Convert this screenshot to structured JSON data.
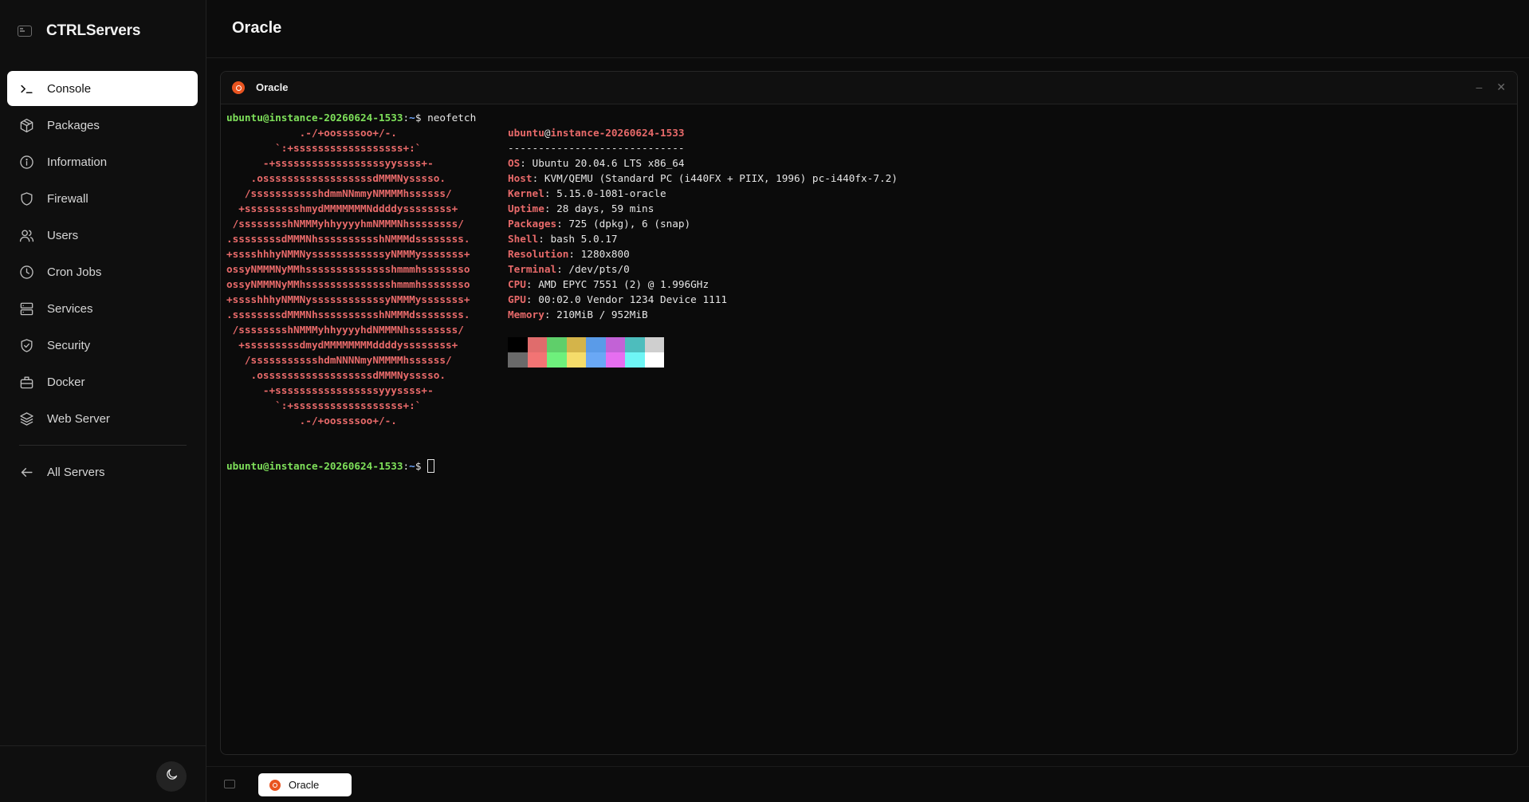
{
  "app": {
    "name": "CTRLServers"
  },
  "sidebar": {
    "items": [
      {
        "label": "Console",
        "icon": "terminal-icon"
      },
      {
        "label": "Packages",
        "icon": "package-icon"
      },
      {
        "label": "Information",
        "icon": "info-icon"
      },
      {
        "label": "Firewall",
        "icon": "shield-icon"
      },
      {
        "label": "Users",
        "icon": "users-icon"
      },
      {
        "label": "Cron Jobs",
        "icon": "clock-icon"
      },
      {
        "label": "Services",
        "icon": "server-icon"
      },
      {
        "label": "Security",
        "icon": "shield-check-icon"
      },
      {
        "label": "Docker",
        "icon": "docker-icon"
      },
      {
        "label": "Web Server",
        "icon": "layers-icon"
      }
    ],
    "back_label": "All Servers"
  },
  "header": {
    "title": "Oracle"
  },
  "terminal": {
    "window_title": "Oracle",
    "prompt_user": "ubuntu@instance-20260624-1533",
    "prompt_sep": ":",
    "prompt_path": "~",
    "prompt_symbol": "$",
    "command": "neofetch",
    "logo_lines": [
      "            .-/+oossssoo+/-.",
      "        `:+ssssssssssssssssss+:`",
      "      -+ssssssssssssssssssyyssss+-",
      "    .ossssssssssssssssssdMMMNysssso.",
      "   /ssssssssssshdmmNNmmyNMMMMhssssss/",
      "  +ssssssssshmydMMMMMMMNddddyssssssss+",
      " /sssssssshNMMMyhhyyyyhmNMMMNhssssssss/",
      ".ssssssssdMMMNhsssssssssshNMMMdssssssss.",
      "+sssshhhyNMMNyssssssssssssyNMMMysssssss+",
      "ossyNMMMNyMMhsssssssssssssshmmmhssssssso",
      "ossyNMMMNyMMhsssssssssssssshmmmhssssssso",
      "+sssshhhyNMMNyssssssssssssyNMMMysssssss+",
      ".ssssssssdMMMNhsssssssssshNMMMdssssssss.",
      " /sssssssshNMMMyhhyyyyhdNMMMNhssssssss/",
      "  +sssssssssdmydMMMMMMMMddddyssssssss+",
      "   /ssssssssssshdmNNNNmyNMMMMhssssss/",
      "    .ossssssssssssssssssdMMMNysssso.",
      "      -+sssssssssssssssssyyyssss+-",
      "        `:+ssssssssssssssssss+:`",
      "            .-/+oossssoo+/-."
    ],
    "info_user": "ubuntu",
    "info_at": "@",
    "info_host": "instance-20260624-1533",
    "info_rule": "-----------------------------",
    "info": [
      {
        "key": "OS",
        "value": ": Ubuntu 20.04.6 LTS x86_64"
      },
      {
        "key": "Host",
        "value": ": KVM/QEMU (Standard PC (i440FX + PIIX, 1996) pc-i440fx-7.2)"
      },
      {
        "key": "Kernel",
        "value": ": 5.15.0-1081-oracle"
      },
      {
        "key": "Uptime",
        "value": ": 28 days, 59 mins"
      },
      {
        "key": "Packages",
        "value": ": 725 (dpkg), 6 (snap)"
      },
      {
        "key": "Shell",
        "value": ": bash 5.0.17"
      },
      {
        "key": "Resolution",
        "value": ": 1280x800"
      },
      {
        "key": "Terminal",
        "value": ": /dev/pts/0"
      },
      {
        "key": "CPU",
        "value": ": AMD EPYC 7551 (2) @ 1.996GHz"
      },
      {
        "key": "GPU",
        "value": ": 00:02.0 Vendor 1234 Device 1111"
      },
      {
        "key": "Memory",
        "value": ": 210MiB / 952MiB"
      }
    ],
    "palette_row1": [
      "#000000",
      "#e06c6c",
      "#5fcf6a",
      "#d4b44a",
      "#5a9be8",
      "#c262d6",
      "#4dbdbd",
      "#cfcfcf"
    ],
    "palette_row2": [
      "#6a6a6a",
      "#f27474",
      "#6ef07c",
      "#f5dc6a",
      "#6aa8f5",
      "#e66ef0",
      "#6ef5f5",
      "#ffffff"
    ]
  },
  "tabbar": {
    "tab_label": "Oracle"
  },
  "colors": {
    "accent_ubuntu": "#e95420",
    "prompt_green": "#7ee05a",
    "logo_red": "#e86a6a"
  }
}
